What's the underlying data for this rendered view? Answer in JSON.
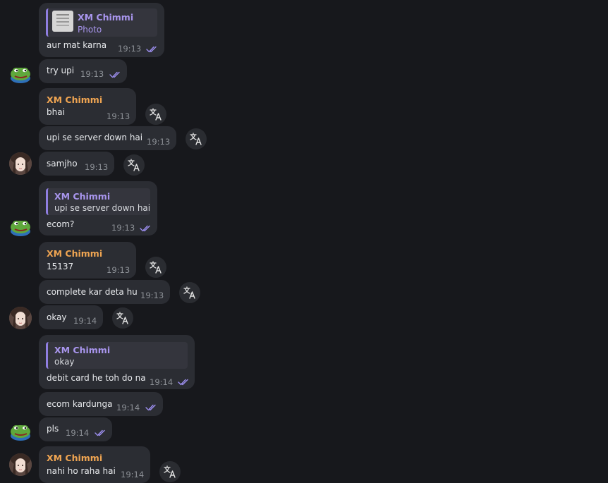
{
  "colors": {
    "background": "#17181c",
    "bubble": "#2b2d33",
    "sender_name": "#f0a552",
    "reply_accent": "#a996ee",
    "read_ticks": "#9d8ff0",
    "timestamp": "#8c9096"
  },
  "messages": [
    {
      "reply": {
        "name": "XM Chimmi",
        "sub": "Photo"
      },
      "text": "aur mat karna",
      "time": "19:13"
    },
    {
      "text": "try upi",
      "time": "19:13"
    },
    {
      "sender": "XM Chimmi",
      "text": "bhai",
      "time": "19:13"
    },
    {
      "text": "upi se server down hai",
      "time": "19:13"
    },
    {
      "text": "samjho",
      "time": "19:13"
    },
    {
      "reply": {
        "name": "XM Chimmi",
        "text": "upi se server down hai"
      },
      "text": "ecom?",
      "time": "19:13"
    },
    {
      "sender": "XM Chimmi",
      "text": "15137",
      "time": "19:13"
    },
    {
      "text": "complete kar deta hu",
      "time": "19:13"
    },
    {
      "text": "okay",
      "time": "19:14"
    },
    {
      "reply": {
        "name": "XM Chimmi",
        "text": "okay"
      },
      "text": "debit card he toh do na",
      "time": "19:14"
    },
    {
      "text": "ecom kardunga",
      "time": "19:14"
    },
    {
      "text": "pls",
      "time": "19:14"
    },
    {
      "sender": "XM Chimmi",
      "text": "nahi ho raha hai",
      "time": "19:14"
    }
  ],
  "icons": {
    "translate": "translate-icon",
    "read_receipt": "double-check-icon",
    "frog_avatar": "frog-avatar",
    "user_avatar": "user-avatar"
  }
}
